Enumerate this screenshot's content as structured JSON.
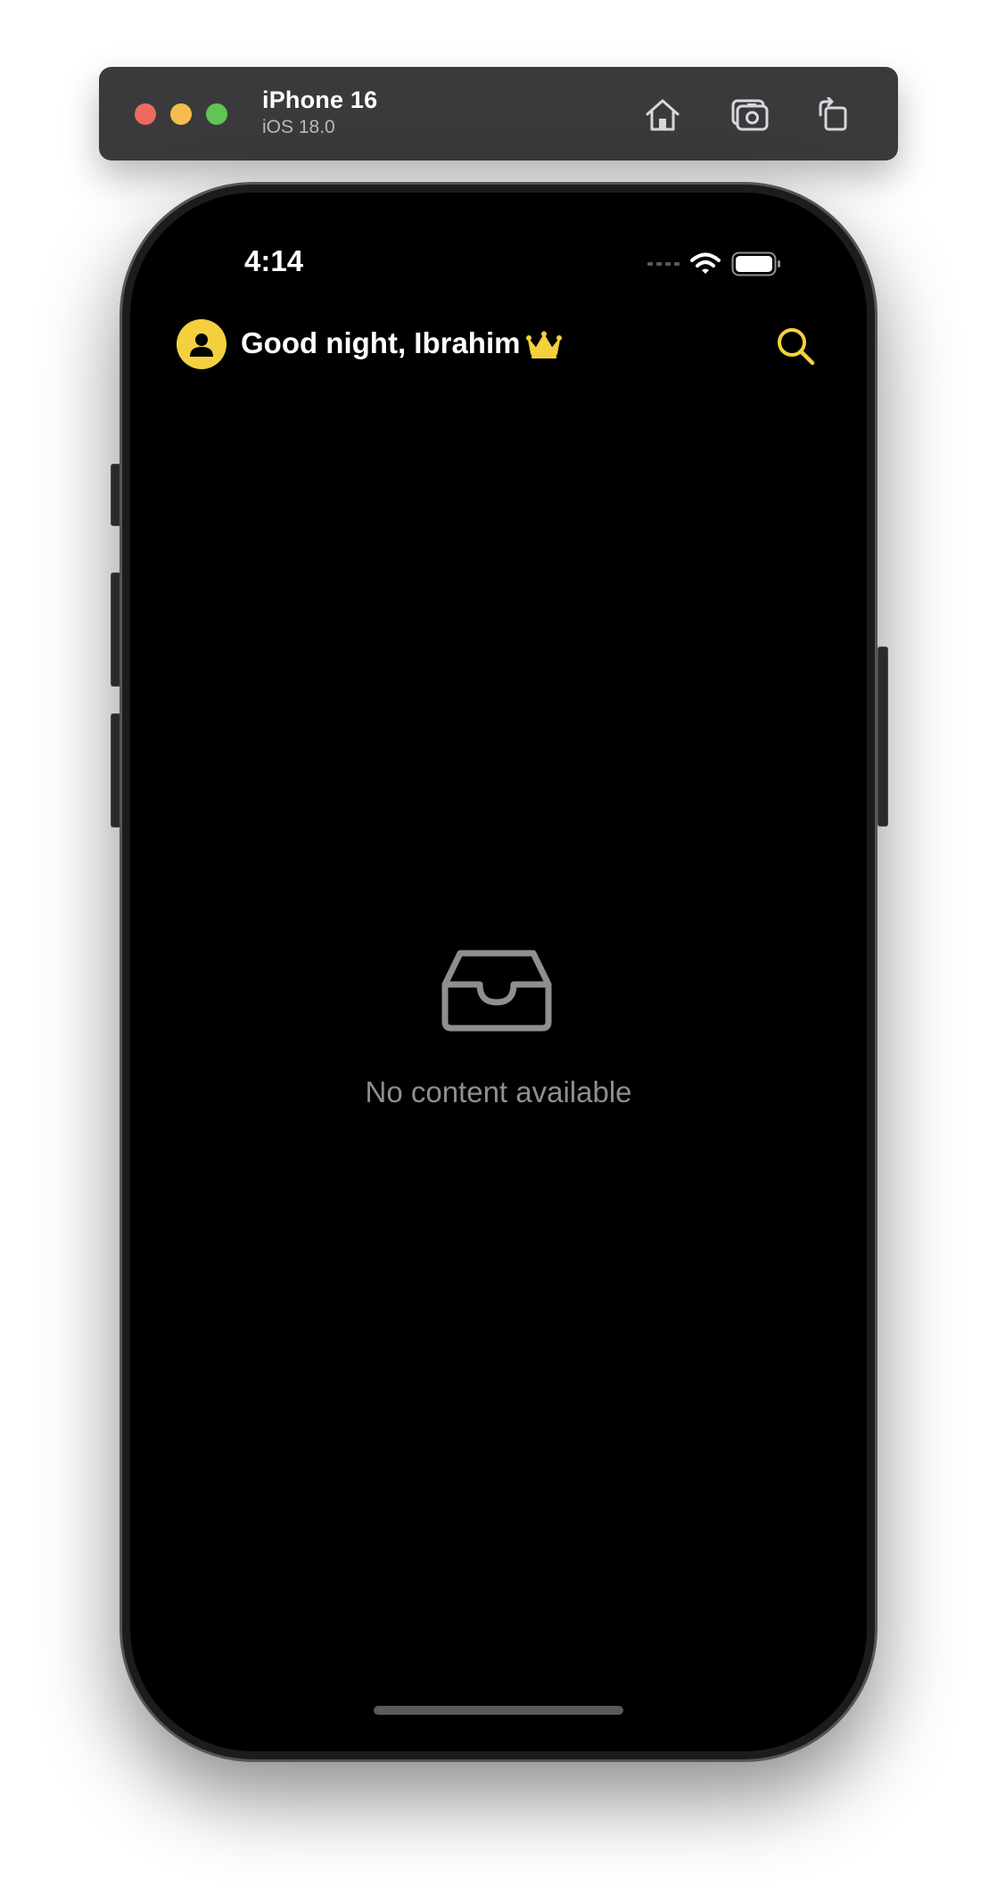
{
  "simulator": {
    "device_name": "iPhone 16",
    "os_version": "iOS 18.0",
    "icons": [
      "home-icon",
      "screenshot-icon",
      "rotate-icon"
    ]
  },
  "status_bar": {
    "time": "4:14",
    "icons": [
      "cellular-signal-icon",
      "wifi-icon",
      "battery-icon"
    ]
  },
  "header": {
    "greeting": "Good night, Ibrahim",
    "icons": [
      "avatar-icon",
      "crown-icon",
      "search-icon"
    ]
  },
  "empty_state": {
    "message": "No content available",
    "icon": "inbox-tray-icon"
  },
  "colors": {
    "accent": "#f4d03f",
    "background": "#000000",
    "muted_text": "#8e8e93"
  }
}
